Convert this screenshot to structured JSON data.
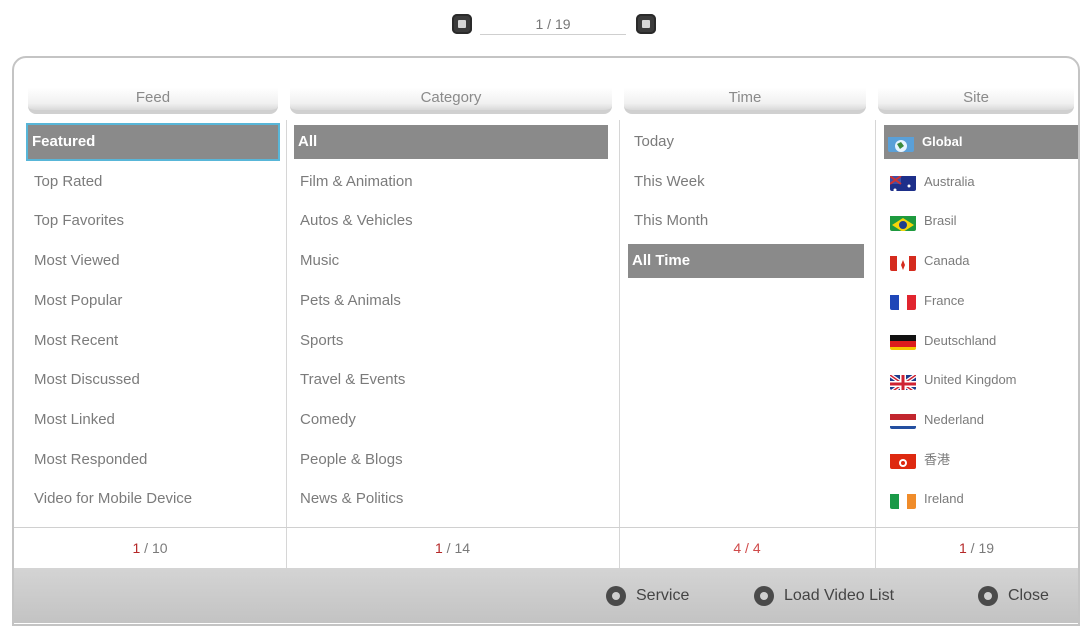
{
  "pager": {
    "text": "1 / 19"
  },
  "columns": {
    "feed": {
      "header": "Feed",
      "items": [
        "Featured",
        "Top Rated",
        "Top Favorites",
        "Most Viewed",
        "Most Popular",
        "Most Recent",
        "Most Discussed",
        "Most Linked",
        "Most Responded",
        "Video for Mobile Device"
      ],
      "selected_index": 0,
      "counter_current": "1",
      "counter_total": "10"
    },
    "category": {
      "header": "Category",
      "items": [
        "All",
        "Film & Animation",
        "Autos & Vehicles",
        "Music",
        "Pets & Animals",
        "Sports",
        "Travel & Events",
        "Comedy",
        "People & Blogs",
        "News & Politics"
      ],
      "selected_index": 0,
      "counter_current": "1",
      "counter_total": "14"
    },
    "time": {
      "header": "Time",
      "items": [
        "Today",
        "This Week",
        "This Month",
        "All Time"
      ],
      "selected_index": 3,
      "counter_current": "4",
      "counter_total": "4"
    },
    "site": {
      "header": "Site",
      "items": [
        "Global",
        "Australia",
        "Brasil",
        "Canada",
        "France",
        "Deutschland",
        "United Kingdom",
        "Nederland",
        "香港",
        "Ireland"
      ],
      "flag_icons": [
        "globe-icon",
        "australia-flag-icon",
        "brazil-flag-icon",
        "canada-flag-icon",
        "france-flag-icon",
        "germany-flag-icon",
        "uk-flag-icon",
        "netherlands-flag-icon",
        "hongkong-flag-icon",
        "ireland-flag-icon"
      ],
      "selected_index": 0,
      "counter_current": "1",
      "counter_total": "19"
    }
  },
  "bottom_bar": {
    "service_label": "Service",
    "load_label": "Load Video List",
    "close_label": "Close"
  },
  "colors": {
    "selection": "#8a8a8a",
    "focus_outline": "#58b6d8",
    "counter_current": "#b52828"
  }
}
